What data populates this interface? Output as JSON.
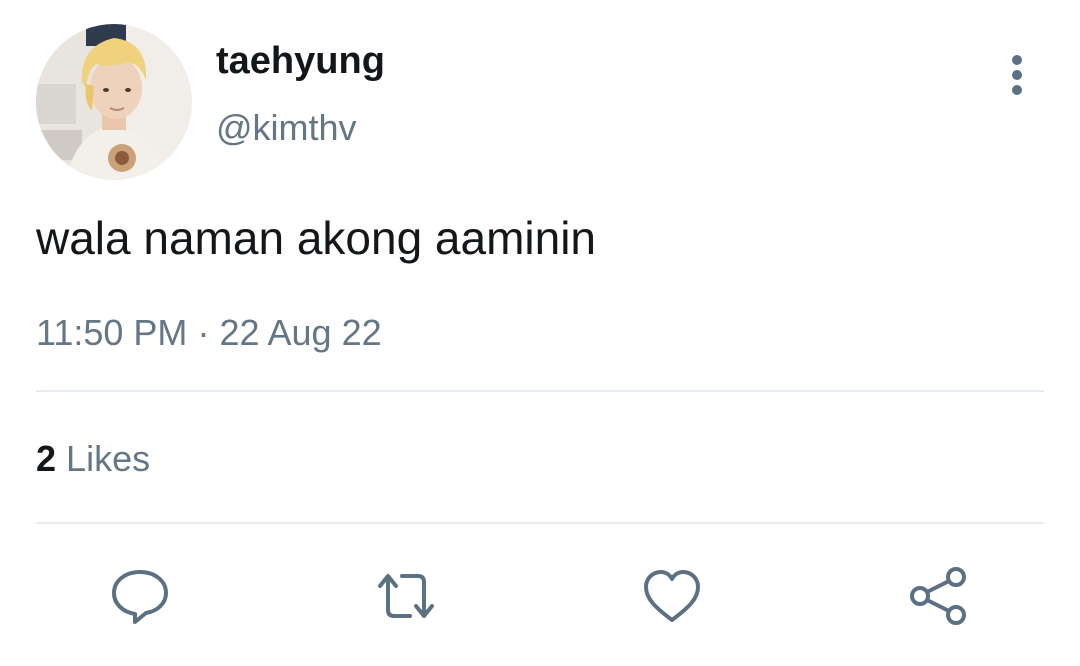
{
  "author": {
    "display_name": "taehyung",
    "handle": "@kimthv",
    "avatar": "profile-photo"
  },
  "tweet": {
    "text": "wala naman akong aaminin",
    "time": "11:50 PM",
    "separator": "·",
    "date": "22 Aug 22"
  },
  "stats": {
    "likes_count": "2",
    "likes_label": "Likes"
  },
  "actions": {
    "reply": "speech-bubble-icon",
    "retweet": "retweet-icon",
    "like": "heart-icon",
    "share": "share-icon"
  },
  "colors": {
    "text_primary": "#14171a",
    "text_secondary": "#657786",
    "icon": "#5b7083",
    "divider": "#e6ecf0"
  }
}
